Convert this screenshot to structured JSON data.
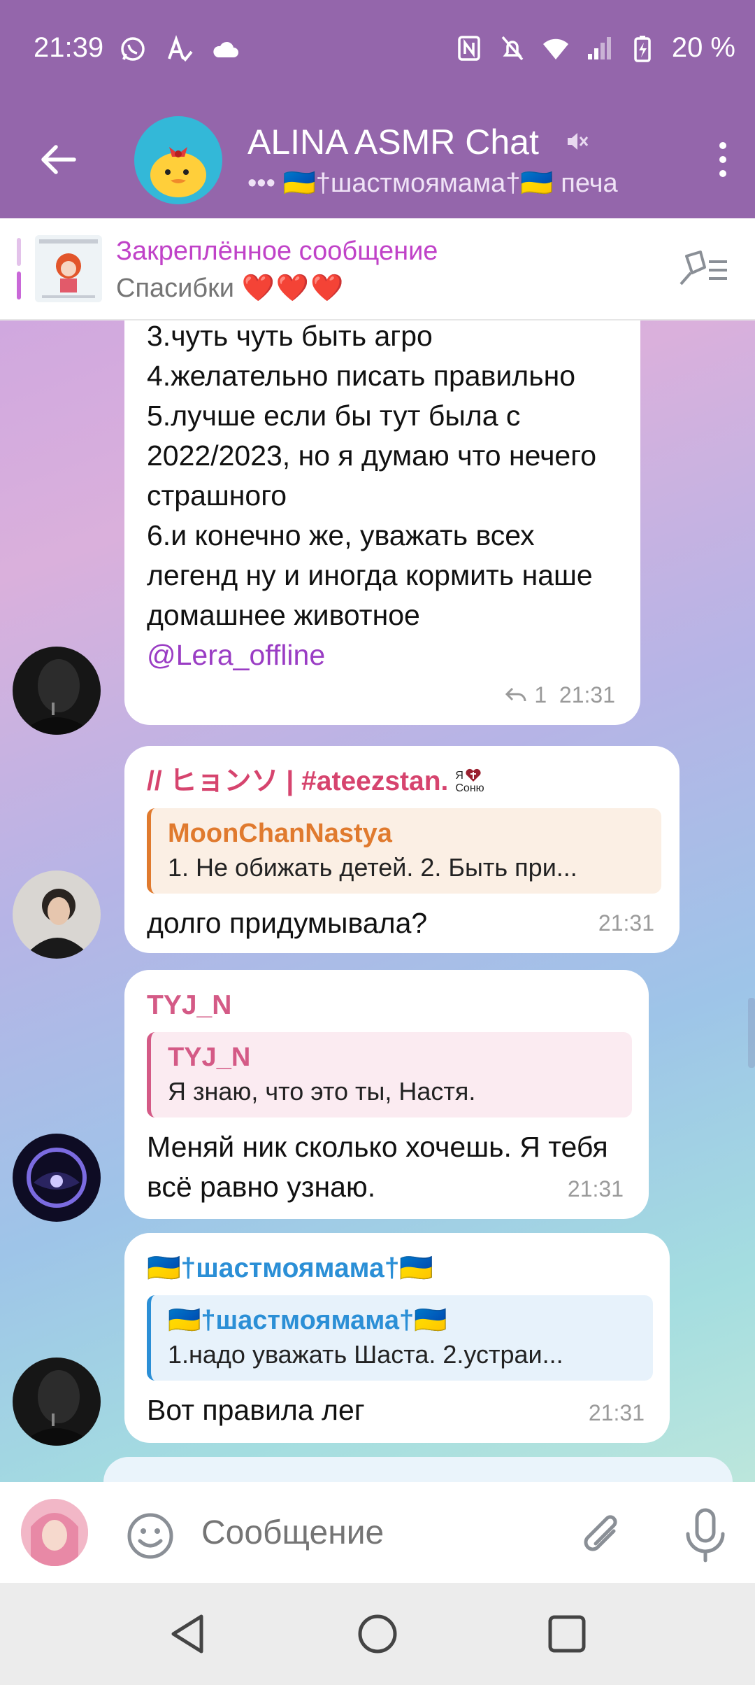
{
  "status_bar": {
    "time": "21:39",
    "battery": "20 %",
    "icons": [
      "whatsapp-icon",
      "autocorrect-icon",
      "cloud-icon",
      "nfc-icon",
      "mute-bell-icon",
      "wifi-icon",
      "signal-icon",
      "battery-charging-icon"
    ]
  },
  "header": {
    "title": "ALINA ASMR Chat",
    "subtitle": "••• 🇺🇦†шастмоямама†🇺🇦 печа",
    "accent": "#9466ab"
  },
  "pinned": {
    "title": "Закреплённое сообщение",
    "text": "Спасибки",
    "hearts": "❤️❤️❤️"
  },
  "messages": [
    {
      "lines": [
        "3.чуть чуть быть агро",
        "4.желательно писать правильно",
        "5.лучше если бы тут была с 2022/2023, но я думаю что нечего страшного",
        "6.и конечно же, уважать всех легенд ну и иногда кормить наше домашнее животное"
      ],
      "mention": "@Lera_offline",
      "replies": "1",
      "time": "21:31"
    },
    {
      "sender": "// ヒョンソ | #ateezstan.",
      "sender_badge_top": "Я",
      "sender_badge_bottom": "Соню",
      "sender_color": "#d6446e",
      "reply": {
        "name": "MoonChanNastya",
        "text": "1. Не обижать детей. 2. Быть при...",
        "color": "#e07a2e",
        "bg": "#fbefe4"
      },
      "text": "долго придумывала?",
      "time": "21:31"
    },
    {
      "sender": "TYJ_N",
      "sender_color": "#d45a86",
      "reply": {
        "name": "TYJ_N",
        "text": "Я знаю, что это ты, Настя.",
        "color": "#d45a86",
        "bg": "#fbebf1"
      },
      "text": "Меняй ник сколько хочешь. Я тебя всё равно узнаю.",
      "time": "21:31"
    },
    {
      "sender": "🇺🇦†шастмоямама†🇺🇦",
      "sender_color": "#2b8fd6",
      "reply": {
        "name": "🇺🇦†шастмоямама†🇺🇦",
        "text": "1.надо уважать Шаста. 2.устраи...",
        "color": "#2b8fd6",
        "bg": "#e7f2fb"
      },
      "text": "Вот правила лег",
      "time": "21:31"
    }
  ],
  "input": {
    "placeholder": "Сообщение"
  }
}
